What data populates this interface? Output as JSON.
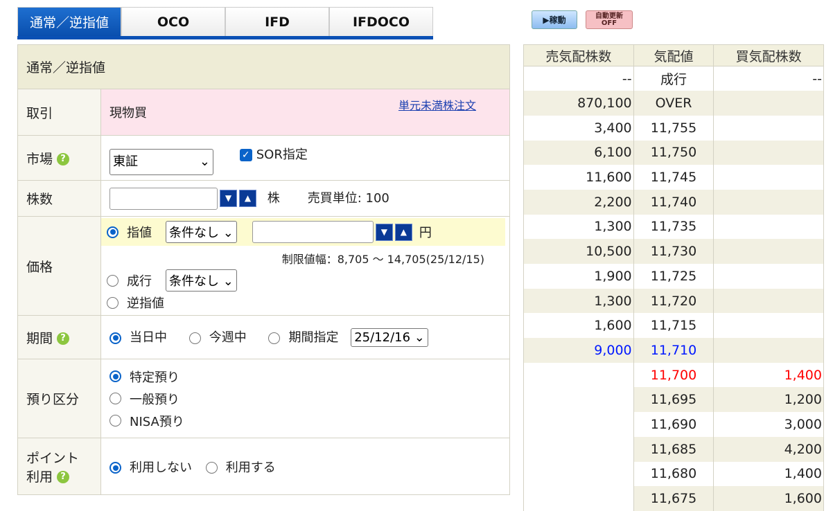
{
  "tabs": [
    "通常／逆指値",
    "OCO",
    "IFD",
    "IFDOCO"
  ],
  "status": {
    "running": "▶稼動",
    "auto_update": "自動更新",
    "auto_update_state": "OFF"
  },
  "form": {
    "title": "通常／逆指値",
    "trade_label": "取引",
    "trade_value": "現物買",
    "odd_lot_link": "単元未満株注文",
    "market_label": "市場",
    "market_value": "東証",
    "sor_label": "SOR指定",
    "qty_label": "株数",
    "qty_value": "",
    "qty_unit": "株",
    "unit_text": "売買単位: 100",
    "price_label": "価格",
    "limit_label": "指値",
    "limit_cond": "条件なし",
    "price_value": "",
    "price_unit": "円",
    "price_range": "制限値幅：8,705 〜 14,705(25/12/15)",
    "market_order_label": "成行",
    "market_cond": "条件なし",
    "stop_label": "逆指値",
    "period_label": "期間",
    "period_opts": [
      "当日中",
      "今週中",
      "期間指定"
    ],
    "period_date": "25/12/16",
    "custody_label": "預り区分",
    "custody_opts": [
      "特定預り",
      "一般預り",
      "NISA預り"
    ],
    "point_label_1": "ポイント",
    "point_label_2": "利用",
    "point_opts": [
      "利用しない",
      "利用する"
    ],
    "help": "?"
  },
  "board": {
    "headers": [
      "売気配株数",
      "気配値",
      "買気配株数"
    ],
    "rows": [
      [
        "--",
        "成行",
        "--"
      ],
      [
        "870,100",
        "OVER",
        ""
      ],
      [
        "3,400",
        "11,755",
        ""
      ],
      [
        "6,100",
        "11,750",
        ""
      ],
      [
        "11,600",
        "11,745",
        ""
      ],
      [
        "2,200",
        "11,740",
        ""
      ],
      [
        "1,300",
        "11,735",
        ""
      ],
      [
        "10,500",
        "11,730",
        ""
      ],
      [
        "1,900",
        "11,725",
        ""
      ],
      [
        "1,300",
        "11,720",
        ""
      ],
      [
        "1,600",
        "11,715",
        ""
      ],
      [
        "9,000",
        "11,710",
        ""
      ],
      [
        "",
        "11,700",
        "1,400"
      ],
      [
        "",
        "11,695",
        "1,200"
      ],
      [
        "",
        "11,690",
        "3,000"
      ],
      [
        "",
        "11,685",
        "4,200"
      ],
      [
        "",
        "11,680",
        "1,400"
      ],
      [
        "",
        "11,675",
        "1,600"
      ]
    ]
  }
}
